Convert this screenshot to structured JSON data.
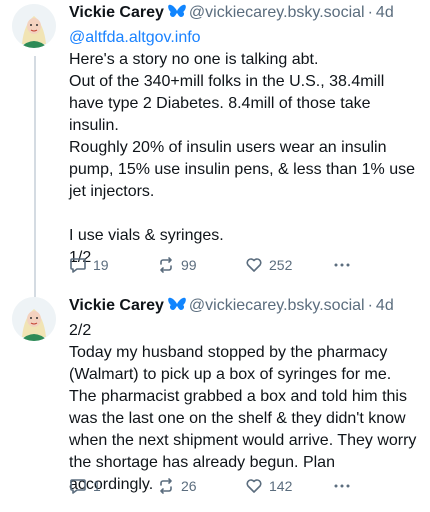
{
  "colors": {
    "link": "#1a82ff",
    "muted": "#5b6d7e",
    "butterfly": "#1185fe",
    "thread_line": "#d4dbe2"
  },
  "posts": [
    {
      "author_name": "Vickie Carey",
      "verified_icon": "butterfly-icon",
      "handle": "@vickiecarey.bsky.social",
      "separator": "·",
      "time": "4d",
      "mention": "@altfda.altgov.info",
      "text": "Here's a story no one is talking abt.\nOut of the 340+mill folks in the U.S., 38.4mill have type 2 Diabetes. 8.4mill of those take insulin.\nRoughly 20% of insulin users wear an insulin pump, 15% use insulin pens, & less than 1% use jet injectors.\n\nI use vials & syringes.\n1/2",
      "replies": "19",
      "reposts": "99",
      "likes": "252"
    },
    {
      "author_name": "Vickie Carey",
      "verified_icon": "butterfly-icon",
      "handle": "@vickiecarey.bsky.social",
      "separator": "·",
      "time": "4d",
      "text": "2/2\nToday my husband stopped by the pharmacy (Walmart) to pick up a box of syringes for me. The pharmacist grabbed a box and told him this was the last one on the shelf & they didn't know when the next shipment would arrive. They worry the shortage has already begun. Plan accordingly.",
      "replies": "1",
      "reposts": "26",
      "likes": "142"
    }
  ]
}
